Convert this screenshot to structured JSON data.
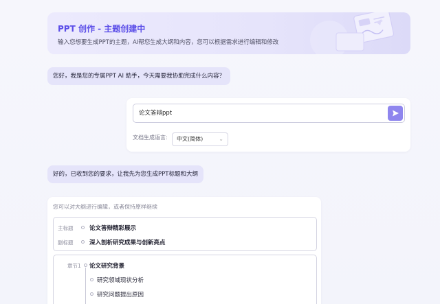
{
  "banner": {
    "title": "PPT 创作 - 主题创建中",
    "description": "输入您想要生成PPT的主题，AI帮您生成大纲和内容，您可以根据需求进行编辑和修改"
  },
  "chat": {
    "greeting": "您好，我是您的专属PPT AI 助手，今天需要我协助完成什么内容？",
    "reply": "好的，已收到您的要求，让我先为您生成PPT标题和大纲"
  },
  "input": {
    "value": "论文答辩ppt",
    "send_icon": "send-icon",
    "language_label": "文档生成语言:",
    "language_value": "中文(简体)"
  },
  "outline": {
    "hint": "您可以对大纲进行编辑，或者保持原样继续",
    "main_title_label": "主标题",
    "main_title": "论文答辩精彩展示",
    "subtitle_label": "副标题",
    "subtitle": "深入剖析研究成果与创新亮点",
    "chapter_label": "章节1",
    "chapter_title": "论文研究背景",
    "sections": [
      "研究领域现状分析",
      "研究问题提出原因"
    ]
  },
  "colors": {
    "accent": "#5b4ee8",
    "send_button": "#8f86ee",
    "bubble": "#e5e4fa"
  }
}
